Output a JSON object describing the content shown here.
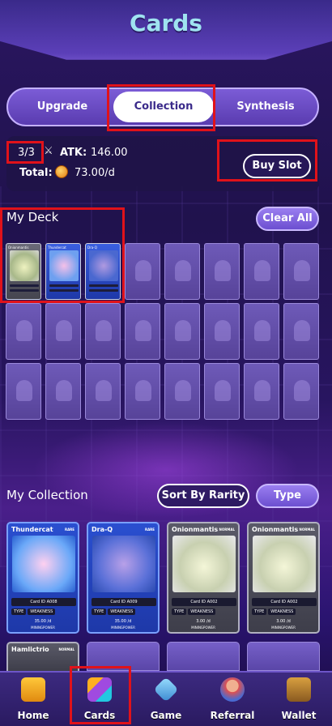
{
  "header": {
    "title": "Cards"
  },
  "tabs": [
    {
      "label": "Upgrade"
    },
    {
      "label": "Collection"
    },
    {
      "label": "Synthesis"
    }
  ],
  "stats": {
    "slot_count": "3/3",
    "atk_label": "ATK:",
    "atk_value": "146.00",
    "total_label": "Total:",
    "total_value": "73.00/d",
    "buy_slot_label": "Buy Slot"
  },
  "deck": {
    "title": "My Deck",
    "clear_all_label": "Clear All",
    "filled_cards": [
      {
        "name": "Onionmantis",
        "color": "#5a5a68"
      },
      {
        "name": "Thundercat",
        "color": "#2a4fd0"
      },
      {
        "name": "Dra-Q",
        "color": "#2a4fd0"
      }
    ]
  },
  "collection": {
    "title": "My Collection",
    "sort_label": "Sort By Rarity",
    "type_label": "Type",
    "cards": [
      {
        "name": "Thundercat",
        "rarity": "RARE",
        "card_id": "Card ID A008",
        "type": "TYPE",
        "weakness": "WEAKNESS",
        "power": "35.00",
        "unit": "/d",
        "mining": "MININGPOWER",
        "style": "blue"
      },
      {
        "name": "Dra-Q",
        "rarity": "RARE",
        "card_id": "Card ID A009",
        "type": "TYPE",
        "weakness": "WEAKNESS",
        "power": "35.00",
        "unit": "/d",
        "mining": "MININGPOWER",
        "style": "blue"
      },
      {
        "name": "Onionmantis",
        "rarity": "NORMAL",
        "card_id": "Card ID A002",
        "type": "TYPE",
        "weakness": "WEAKNESS",
        "power": "3.00",
        "unit": "/d",
        "mining": "MININGPOWER",
        "style": "gray"
      },
      {
        "name": "Onionmantis",
        "rarity": "NORMAL",
        "card_id": "Card ID A002",
        "type": "TYPE",
        "weakness": "WEAKNESS",
        "power": "3.00",
        "unit": "/d",
        "mining": "MININGPOWER",
        "style": "gray"
      }
    ],
    "partial_card": {
      "name": "Hamlictrio",
      "rarity": "NORMAL"
    }
  },
  "nav": [
    {
      "label": "Home",
      "icon": "castle-icon"
    },
    {
      "label": "Cards",
      "icon": "cards-icon"
    },
    {
      "label": "Game",
      "icon": "sword-icon"
    },
    {
      "label": "Referral",
      "icon": "person-icon"
    },
    {
      "label": "Wallet",
      "icon": "chest-icon"
    }
  ],
  "colors": {
    "accent": "#7b5cd6",
    "highlight": "#e0121a",
    "blue_card": "#2a4fd0",
    "gray_card": "#5a5a68"
  }
}
